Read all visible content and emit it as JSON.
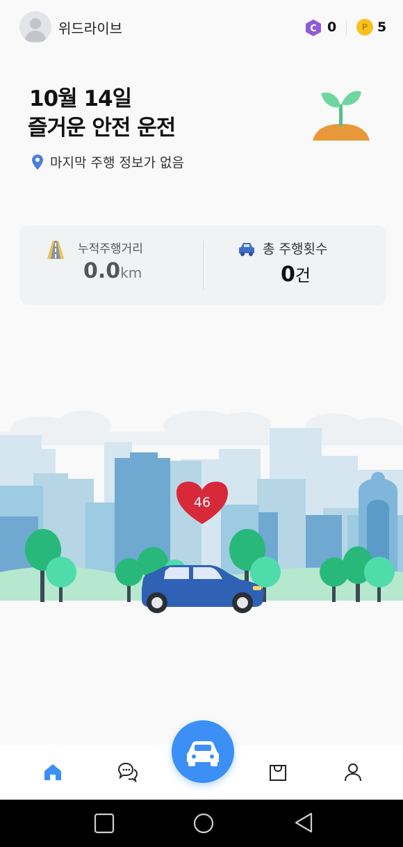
{
  "header": {
    "app_title": "위드라이브",
    "coins": {
      "c_icon": "C",
      "c_value": "0",
      "p_icon": "P",
      "p_value": "5"
    }
  },
  "greeting": {
    "date": "10월 14일",
    "message": "즐거운 안전 운전",
    "last_drive": "마지막 주행 정보가 없음"
  },
  "stats": {
    "distance_label": "누적주행거리",
    "distance_value": "0.0",
    "distance_unit": "km",
    "count_label": "총 주행횟수",
    "count_value": "0",
    "count_unit": "건"
  },
  "scene": {
    "heart_value": "46"
  },
  "nav": {
    "items": [
      "home-icon",
      "chat-icon",
      "drive-car-icon",
      "shop-bag-icon",
      "profile-icon"
    ],
    "active": "home-icon"
  },
  "colors": {
    "accent": "#3b8ff5",
    "heart": "#d8293b",
    "car": "#2f62b5",
    "coin_c": "#8e5bd8",
    "coin_p": "#f7c21d"
  }
}
